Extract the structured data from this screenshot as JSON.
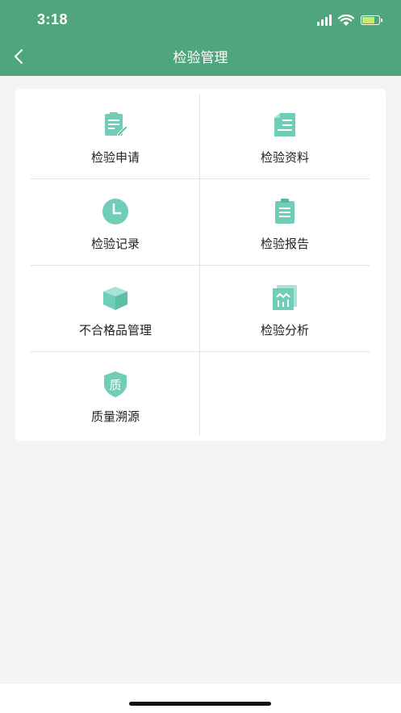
{
  "status": {
    "time": "3:18"
  },
  "header": {
    "title": "检验管理"
  },
  "menu": {
    "items": [
      {
        "label": "检验申请",
        "icon": "edit-document-icon"
      },
      {
        "label": "检验资料",
        "icon": "file-list-icon"
      },
      {
        "label": "检验记录",
        "icon": "clock-icon"
      },
      {
        "label": "检验报告",
        "icon": "clipboard-icon"
      },
      {
        "label": "不合格品管理",
        "icon": "box-icon"
      },
      {
        "label": "检验分析",
        "icon": "chart-icon"
      },
      {
        "label": "质量溯源",
        "icon": "quality-shield-icon",
        "badge": "质"
      }
    ]
  },
  "colors": {
    "header": "#4fa57c",
    "icon": "#6fcdb8",
    "background": "#f4f4f4"
  }
}
